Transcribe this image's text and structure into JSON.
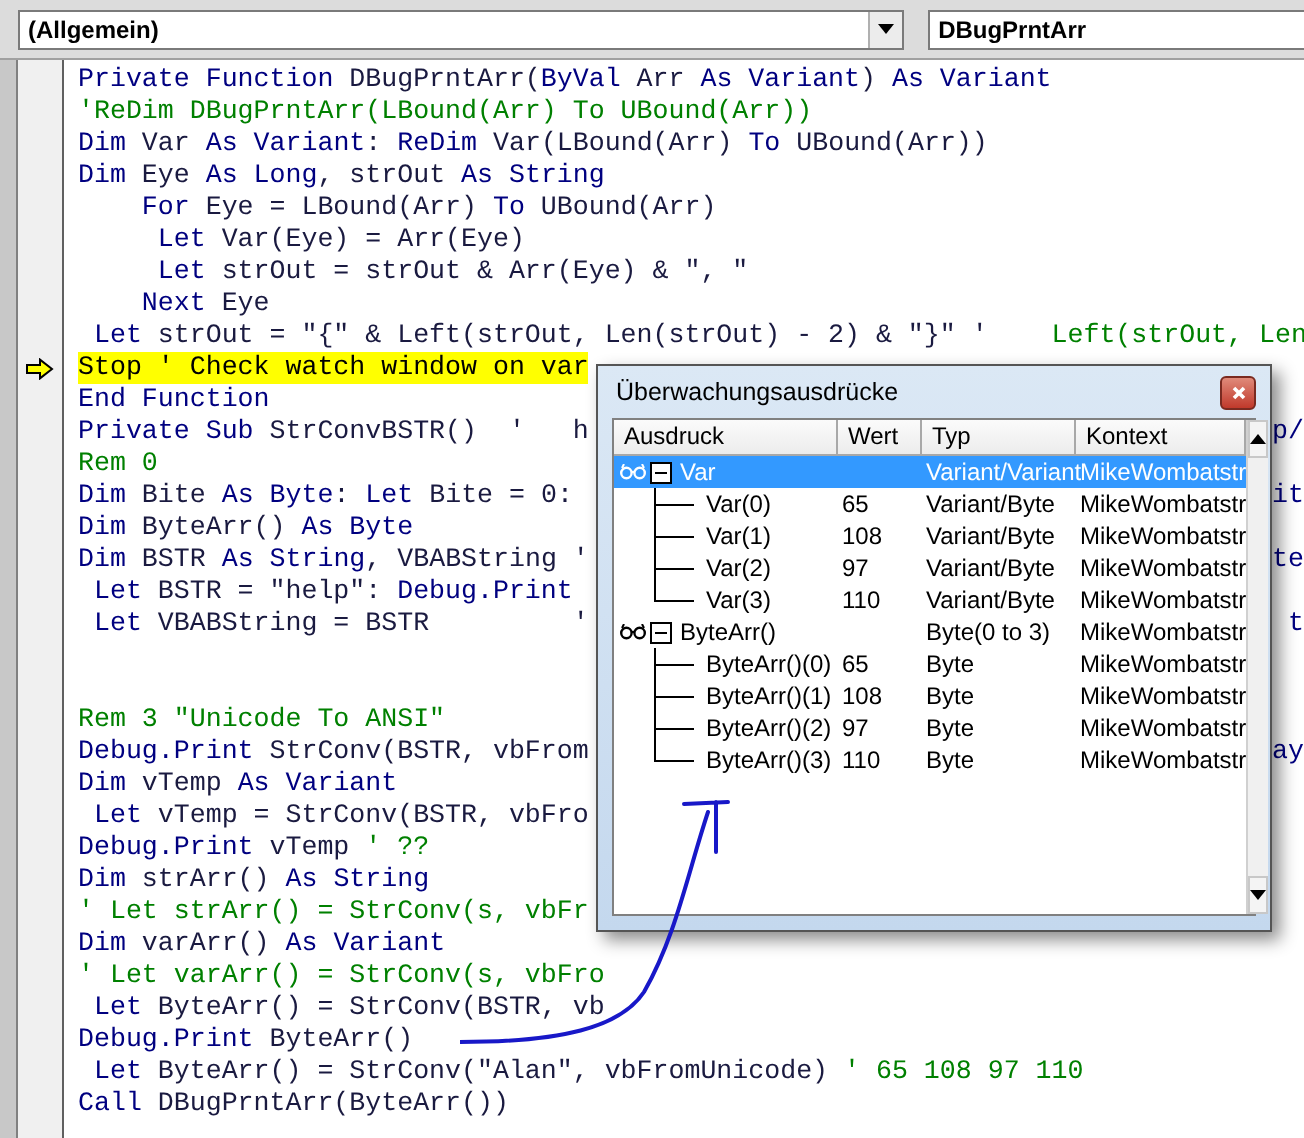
{
  "toolbar": {
    "object_combo": "(Allgemein)",
    "procedure_combo": "DBugPrntArr"
  },
  "code_lines": [
    {
      "kind": "code",
      "segments": [
        {
          "kind": "kw",
          "text": "Private Function"
        },
        {
          "kind": "id",
          "text": " DBugPrntArr("
        },
        {
          "kind": "kw",
          "text": "ByVal"
        },
        {
          "kind": "id",
          "text": " Arr "
        },
        {
          "kind": "kw",
          "text": "As Variant"
        },
        {
          "kind": "id",
          "text": ") "
        },
        {
          "kind": "kw",
          "text": "As Variant"
        }
      ]
    },
    {
      "kind": "code",
      "segments": [
        {
          "kind": "comment",
          "text": "'ReDim DBugPrntArr(LBound(Arr) To UBound(Arr))"
        }
      ]
    },
    {
      "kind": "code",
      "segments": [
        {
          "kind": "kw",
          "text": "Dim"
        },
        {
          "kind": "id",
          "text": " Var "
        },
        {
          "kind": "kw",
          "text": "As Variant"
        },
        {
          "kind": "id",
          "text": ": "
        },
        {
          "kind": "kw",
          "text": "ReDim"
        },
        {
          "kind": "id",
          "text": " Var(LBound(Arr) "
        },
        {
          "kind": "kw",
          "text": "To"
        },
        {
          "kind": "id",
          "text": " UBound(Arr))"
        }
      ]
    },
    {
      "kind": "code",
      "segments": [
        {
          "kind": "kw",
          "text": "Dim"
        },
        {
          "kind": "id",
          "text": " Eye "
        },
        {
          "kind": "kw",
          "text": "As Long"
        },
        {
          "kind": "id",
          "text": ", strOut "
        },
        {
          "kind": "kw",
          "text": "As String"
        }
      ]
    },
    {
      "kind": "code",
      "segments": [
        {
          "kind": "kw",
          "text": "    For"
        },
        {
          "kind": "id",
          "text": " Eye = LBound(Arr) "
        },
        {
          "kind": "kw",
          "text": "To"
        },
        {
          "kind": "id",
          "text": " UBound(Arr)"
        }
      ]
    },
    {
      "kind": "code",
      "segments": [
        {
          "kind": "kw",
          "text": "     Let"
        },
        {
          "kind": "id",
          "text": " Var(Eye) = Arr(Eye)"
        }
      ]
    },
    {
      "kind": "code",
      "segments": [
        {
          "kind": "kw",
          "text": "     Let"
        },
        {
          "kind": "id",
          "text": " strOut = strOut & Arr(Eye) & \", \""
        }
      ]
    },
    {
      "kind": "code",
      "segments": [
        {
          "kind": "kw",
          "text": "    Next"
        },
        {
          "kind": "id",
          "text": " Eye"
        }
      ]
    },
    {
      "kind": "code",
      "segments": [
        {
          "kind": "kw",
          "text": " Let"
        },
        {
          "kind": "id",
          "text": " strOut = \"{\" & Left(strOut, Len(strOut) - 2) & \"}\" '"
        },
        {
          "kind": "comment",
          "text": "    Left(strOut, Len"
        }
      ]
    },
    {
      "kind": "code",
      "current": true,
      "segments": [
        {
          "kind": "id",
          "text": "Stop ' Check watch window on var"
        }
      ]
    },
    {
      "kind": "code",
      "segments": [
        {
          "kind": "kw",
          "text": "End Function"
        }
      ]
    },
    {
      "kind": "code",
      "tail": "p/",
      "segments": [
        {
          "kind": "kw",
          "text": "Private Sub"
        },
        {
          "kind": "id",
          "text": " StrConvBSTR()  '   h"
        }
      ]
    },
    {
      "kind": "code",
      "segments": [
        {
          "kind": "comment",
          "text": "Rem 0"
        }
      ]
    },
    {
      "kind": "code",
      "tail": "it",
      "segments": [
        {
          "kind": "kw",
          "text": "Dim"
        },
        {
          "kind": "id",
          "text": " Bite "
        },
        {
          "kind": "kw",
          "text": "As Byte"
        },
        {
          "kind": "id",
          "text": ": "
        },
        {
          "kind": "kw",
          "text": "Let"
        },
        {
          "kind": "id",
          "text": " Bite = 0:"
        }
      ]
    },
    {
      "kind": "code",
      "segments": [
        {
          "kind": "kw",
          "text": "Dim"
        },
        {
          "kind": "id",
          "text": " ByteArr() "
        },
        {
          "kind": "kw",
          "text": "As Byte"
        }
      ]
    },
    {
      "kind": "code",
      "tail": "te",
      "segments": [
        {
          "kind": "kw",
          "text": "Dim"
        },
        {
          "kind": "id",
          "text": " BSTR "
        },
        {
          "kind": "kw",
          "text": "As String"
        },
        {
          "kind": "id",
          "text": ", VBABString '"
        }
      ]
    },
    {
      "kind": "code",
      "segments": [
        {
          "kind": "kw",
          "text": " Let"
        },
        {
          "kind": "id",
          "text": " BSTR = \"help\": "
        },
        {
          "kind": "kw",
          "text": "Debug.Print"
        }
      ]
    },
    {
      "kind": "code",
      "tail": "t",
      "segments": [
        {
          "kind": "kw",
          "text": " Let"
        },
        {
          "kind": "id",
          "text": " VBABString = BSTR         '"
        }
      ]
    },
    {
      "kind": "blank"
    },
    {
      "kind": "blank"
    },
    {
      "kind": "code",
      "segments": [
        {
          "kind": "comment",
          "text": "Rem 3 \"Unicode To ANSI\""
        }
      ]
    },
    {
      "kind": "code",
      "tail": "ay",
      "segments": [
        {
          "kind": "kw",
          "text": "Debug.Print"
        },
        {
          "kind": "id",
          "text": " StrConv(BSTR, vbFrom"
        }
      ]
    },
    {
      "kind": "code",
      "segments": [
        {
          "kind": "kw",
          "text": "Dim"
        },
        {
          "kind": "id",
          "text": " vTemp "
        },
        {
          "kind": "kw",
          "text": "As Variant"
        }
      ]
    },
    {
      "kind": "code",
      "segments": [
        {
          "kind": "kw",
          "text": " Let"
        },
        {
          "kind": "id",
          "text": " vTemp = StrConv(BSTR, vbFro"
        }
      ]
    },
    {
      "kind": "code",
      "segments": [
        {
          "kind": "kw",
          "text": "Debug.Print"
        },
        {
          "kind": "id",
          "text": " vTemp "
        },
        {
          "kind": "comment",
          "text": "' ??"
        }
      ]
    },
    {
      "kind": "code",
      "segments": [
        {
          "kind": "kw",
          "text": "Dim"
        },
        {
          "kind": "id",
          "text": " strArr() "
        },
        {
          "kind": "kw",
          "text": "As String"
        }
      ]
    },
    {
      "kind": "code",
      "segments": [
        {
          "kind": "comment",
          "text": "' Let strArr() = StrConv(s, vbFr"
        }
      ]
    },
    {
      "kind": "code",
      "segments": [
        {
          "kind": "kw",
          "text": "Dim"
        },
        {
          "kind": "id",
          "text": " varArr() "
        },
        {
          "kind": "kw",
          "text": "As Variant"
        }
      ]
    },
    {
      "kind": "code",
      "segments": [
        {
          "kind": "comment",
          "text": "' Let varArr() = StrConv(s, vbFro"
        }
      ]
    },
    {
      "kind": "code",
      "segments": [
        {
          "kind": "kw",
          "text": " Let"
        },
        {
          "kind": "id",
          "text": " ByteArr() = StrConv(BSTR, vb"
        }
      ]
    },
    {
      "kind": "code",
      "segments": [
        {
          "kind": "kw",
          "text": "Debug.Print"
        },
        {
          "kind": "id",
          "text": " ByteArr()"
        }
      ]
    },
    {
      "kind": "code",
      "segments": [
        {
          "kind": "kw",
          "text": " Let"
        },
        {
          "kind": "id",
          "text": " ByteArr() = StrConv(\"Alan\", vbFromUnicode) "
        },
        {
          "kind": "comment",
          "text": "' 65 108 97 110"
        }
      ]
    },
    {
      "kind": "code",
      "segments": [
        {
          "kind": "kw",
          "text": "Call"
        },
        {
          "kind": "id",
          "text": " DBugPrntArr(ByteArr())"
        }
      ]
    }
  ],
  "watch_window": {
    "title": "Überwachungsausdrücke",
    "columns": [
      "Ausdruck",
      "Wert",
      "Typ",
      "Kontext"
    ],
    "watches": [
      {
        "expression": "Var",
        "type": "Variant/Variant",
        "context": "MikeWombatstr",
        "selected": true,
        "expanded": true,
        "children": [
          {
            "expression": "Var(0)",
            "value": "65",
            "type": "Variant/Byte",
            "context": "MikeWombatstr"
          },
          {
            "expression": "Var(1)",
            "value": "108",
            "type": "Variant/Byte",
            "context": "MikeWombatstr"
          },
          {
            "expression": "Var(2)",
            "value": "97",
            "type": "Variant/Byte",
            "context": "MikeWombatstr"
          },
          {
            "expression": "Var(3)",
            "value": "110",
            "type": "Variant/Byte",
            "context": "MikeWombatstr"
          }
        ]
      },
      {
        "expression": "ByteArr()",
        "type": "Byte(0 to 3)",
        "context": "MikeWombatstr",
        "selected": false,
        "expanded": true,
        "children": [
          {
            "expression": "ByteArr()(0)",
            "value": "65",
            "type": "Byte",
            "context": "MikeWombatstr"
          },
          {
            "expression": "ByteArr()(1)",
            "value": "108",
            "type": "Byte",
            "context": "MikeWombatstr"
          },
          {
            "expression": "ByteArr()(2)",
            "value": "97",
            "type": "Byte",
            "context": "MikeWombatstr"
          },
          {
            "expression": "ByteArr()(3)",
            "value": "110",
            "type": "Byte",
            "context": "MikeWombatstr"
          }
        ]
      }
    ]
  }
}
